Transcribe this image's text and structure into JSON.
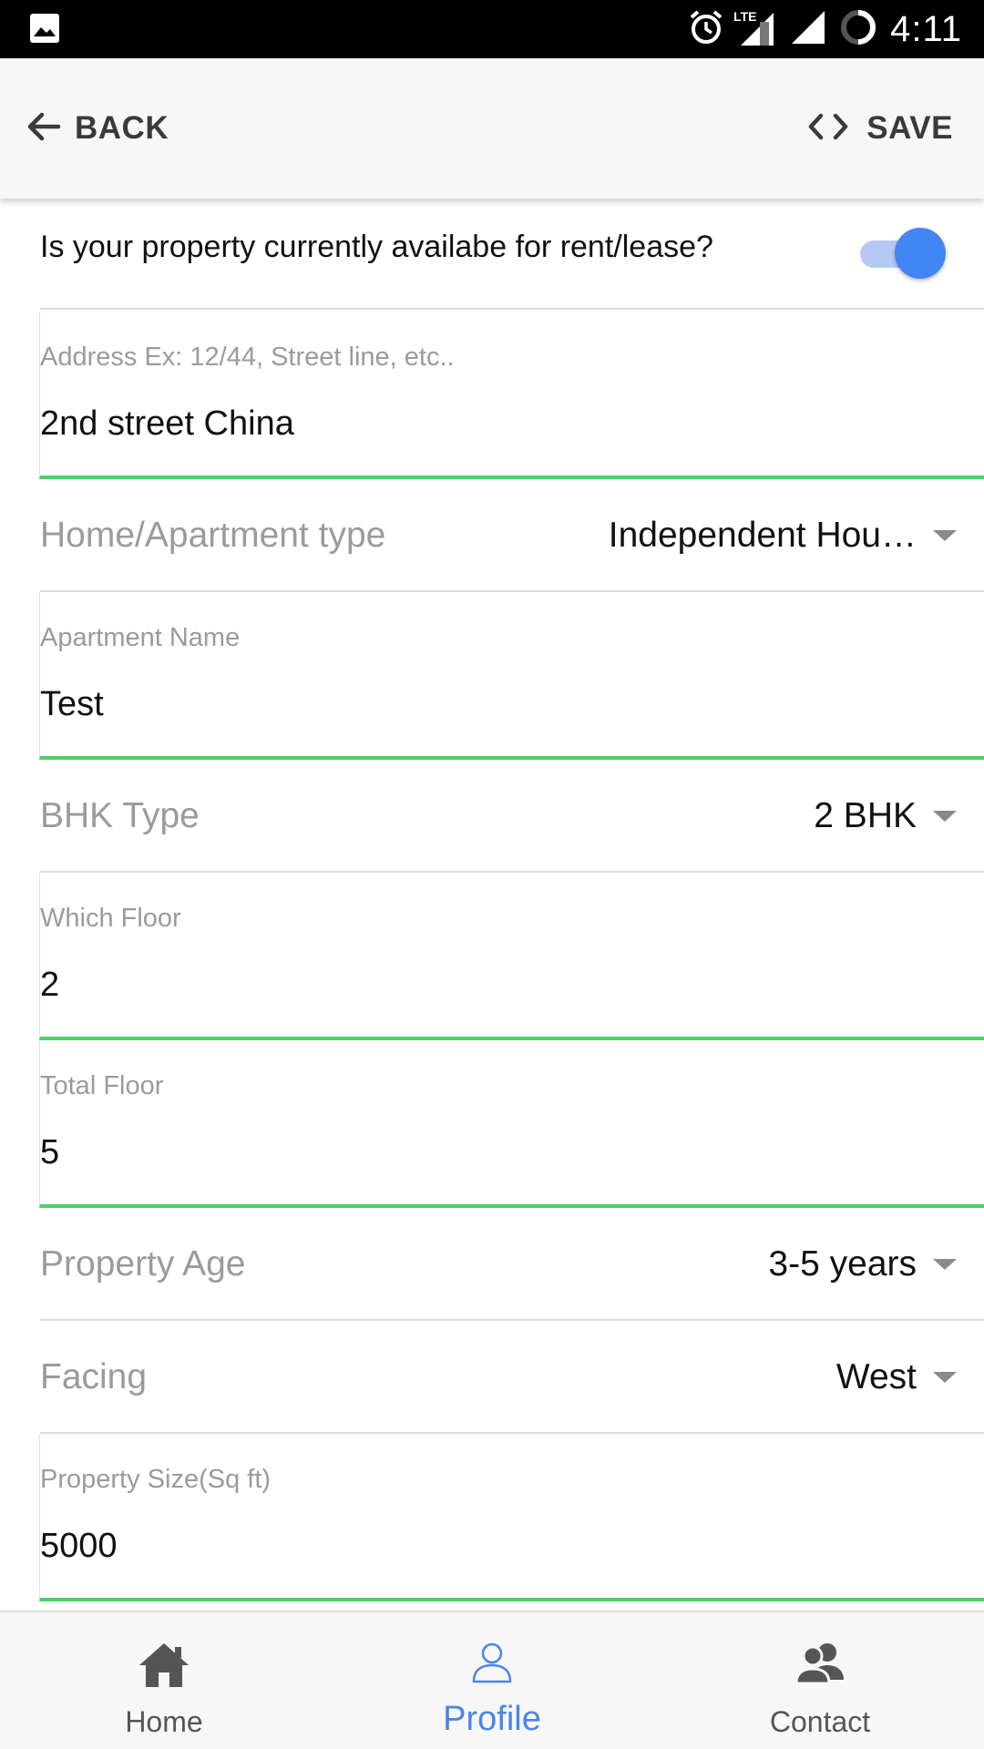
{
  "status_bar": {
    "time": "4:11",
    "network": "LTE",
    "icons": [
      "image-icon",
      "alarm-icon",
      "lte-signal-icon",
      "signal-icon",
      "battery-icon"
    ]
  },
  "header": {
    "back_label": "BACK",
    "save_label": "SAVE",
    "icons": [
      "arrow-left-icon",
      "code-icon"
    ]
  },
  "form": {
    "availability": {
      "question": "Is your property currently availabe for rent/lease?",
      "enabled": true
    },
    "address": {
      "label": "Address Ex: 12/44, Street line, etc..",
      "value": "2nd street China"
    },
    "home_type": {
      "label": "Home/Apartment type",
      "value": "Independent Hou…"
    },
    "apartment_name": {
      "label": "Apartment Name",
      "value": "Test"
    },
    "bhk_type": {
      "label": "BHK Type",
      "value": "2 BHK"
    },
    "which_floor": {
      "label": "Which Floor",
      "value": "2"
    },
    "total_floor": {
      "label": "Total Floor",
      "value": "5"
    },
    "property_age": {
      "label": "Property Age",
      "value": "3-5 years"
    },
    "facing": {
      "label": "Facing",
      "value": "West"
    },
    "property_size": {
      "label": "Property Size(Sq ft)",
      "value": "5000"
    }
  },
  "bottom_nav": {
    "items": [
      {
        "label": "Home",
        "icon": "home-icon",
        "active": false
      },
      {
        "label": "Profile",
        "icon": "user-icon",
        "active": true
      },
      {
        "label": "Contact",
        "icon": "contacts-icon",
        "active": false
      }
    ]
  },
  "colors": {
    "accent_blue": "#4286f4",
    "active_nav": "#4a86e8",
    "input_underline": "#4ccf6a",
    "header_bg": "#f7f7f7"
  }
}
